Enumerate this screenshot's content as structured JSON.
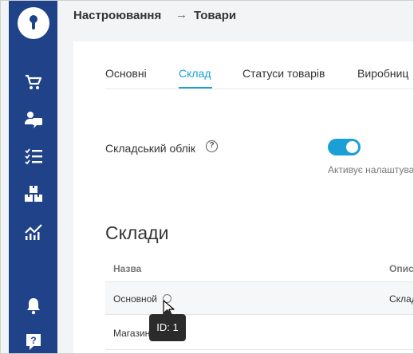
{
  "header": {
    "breadcrumb_parent": "Настроювання",
    "breadcrumb_separator": "→",
    "breadcrumb_current": "Товари"
  },
  "sidebar": {
    "items": [
      {
        "icon": "cart-icon"
      },
      {
        "icon": "customers-icon"
      },
      {
        "icon": "tasks-list-icon"
      },
      {
        "icon": "products-boxes-icon"
      },
      {
        "icon": "analytics-chart-icon"
      },
      {
        "icon": "bell-icon"
      },
      {
        "icon": "help-icon"
      }
    ]
  },
  "tabs": [
    {
      "label": "Основні",
      "active": false
    },
    {
      "label": "Склад",
      "active": true
    },
    {
      "label": "Статуси товарів",
      "active": false
    },
    {
      "label": "Виробниц",
      "active": false
    }
  ],
  "stock_setting": {
    "label": "Складський облік",
    "help_glyph": "?",
    "enabled": true,
    "hint": "Активує налаштува"
  },
  "warehouses": {
    "title": "Склади",
    "columns": [
      "Назва",
      "Опис"
    ],
    "rows": [
      {
        "name": "Основной",
        "description": "Склад"
      },
      {
        "name": "Магазин",
        "description": ""
      }
    ]
  },
  "tooltip": {
    "text": "ID: 1"
  },
  "colors": {
    "sidebar": "#1f4289",
    "accent": "#1aa0d6",
    "tooltip_bg": "#2b2b2b"
  }
}
